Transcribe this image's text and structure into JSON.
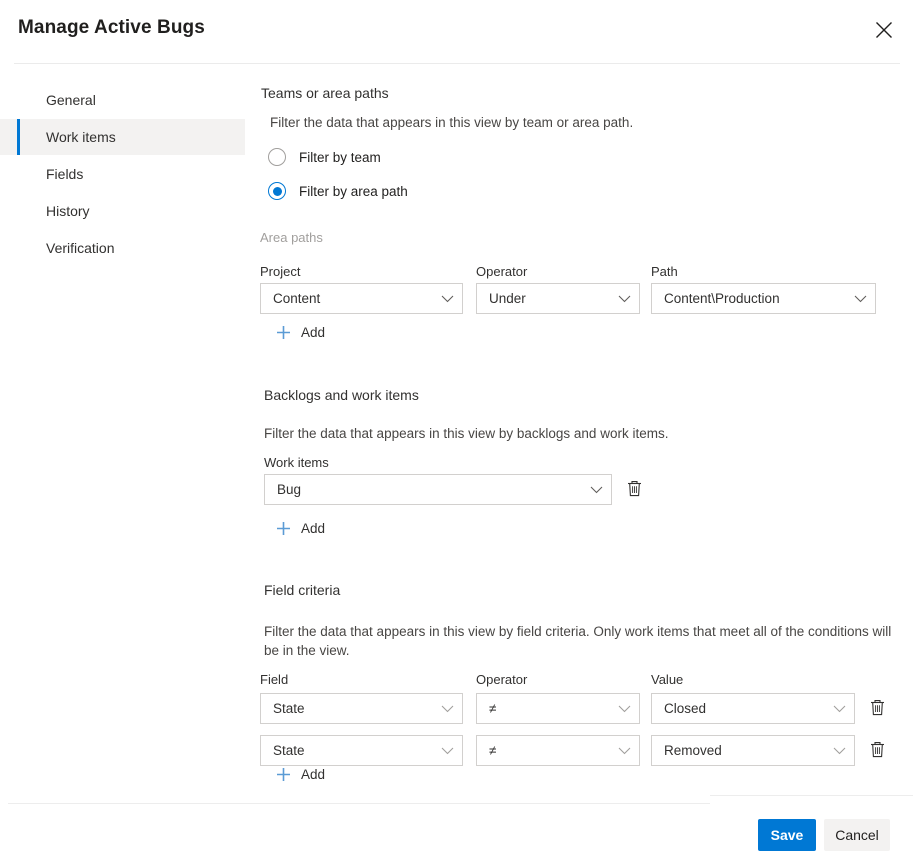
{
  "dialog": {
    "title": "Manage Active Bugs",
    "close_icon": "close-icon"
  },
  "sidebar": {
    "items": [
      {
        "label": "General",
        "selected": false
      },
      {
        "label": "Work items",
        "selected": true
      },
      {
        "label": "Fields",
        "selected": false
      },
      {
        "label": "History",
        "selected": false
      },
      {
        "label": "Verification",
        "selected": false
      }
    ]
  },
  "teams_section": {
    "title": "Teams or area paths",
    "description": "Filter the data that appears in this view by team or area path.",
    "options": [
      {
        "label": "Filter by team",
        "checked": false
      },
      {
        "label": "Filter by area path",
        "checked": true
      }
    ]
  },
  "area_paths": {
    "label": "Area paths",
    "columns": {
      "project": "Project",
      "operator": "Operator",
      "path": "Path"
    },
    "rows": [
      {
        "project": "Content",
        "operator": "Under",
        "path": "Content\\Production"
      }
    ],
    "add_label": "Add",
    "add_icon": "plus-icon"
  },
  "backlogs_section": {
    "title": "Backlogs and work items",
    "description": "Filter the data that appears in this view by backlogs and work items.",
    "work_items_label": "Work items",
    "rows": [
      {
        "value": "Bug",
        "delete_icon": "trash-icon"
      }
    ],
    "add_label": "Add",
    "add_icon": "plus-icon"
  },
  "field_criteria": {
    "title": "Field criteria",
    "description": "Filter the data that appears in this view by field criteria. Only work items that meet all of the conditions will be in the view.",
    "columns": {
      "field": "Field",
      "operator": "Operator",
      "value": "Value"
    },
    "rows": [
      {
        "field": "State",
        "operator": "≠",
        "value": "Closed",
        "delete_icon": "trash-icon"
      },
      {
        "field": "State",
        "operator": "≠",
        "value": "Removed",
        "delete_icon": "trash-icon"
      }
    ],
    "add_label": "Add",
    "add_icon": "plus-icon"
  },
  "footer": {
    "save_label": "Save",
    "cancel_label": "Cancel"
  },
  "colors": {
    "accent": "#0078d4",
    "border": "#d2d0ce",
    "selected_bg": "#f3f2f1",
    "muted_text": "#a19f9d",
    "add_icon": "#5b9bd5"
  }
}
